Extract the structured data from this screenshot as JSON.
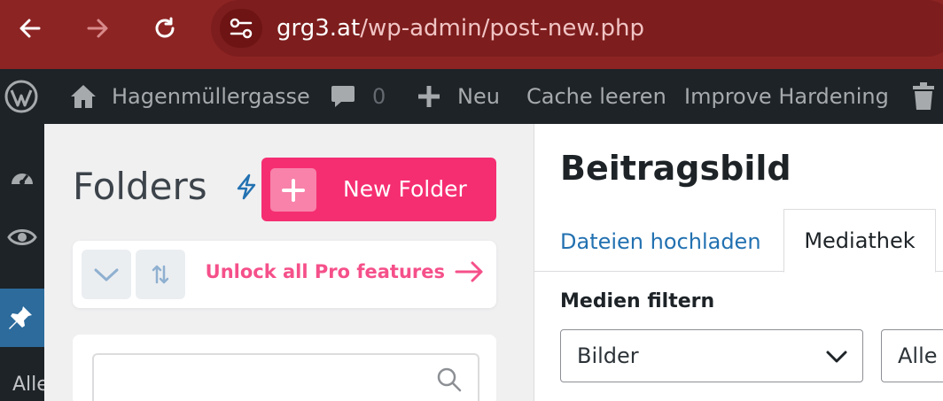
{
  "browser": {
    "url_host": "grg3.at",
    "url_path": "/wp-admin/post-new.php"
  },
  "admin_bar": {
    "site_name": "Hagenmüllergasse",
    "comments_count": "0",
    "new_label": "Neu",
    "cache_label": "Cache leeren",
    "hardening_label": "Improve Hardening"
  },
  "side_menu": {
    "partial_label": "Alle"
  },
  "folders": {
    "title": "Folders",
    "new_folder_label": "New Folder",
    "unlock_label": "Unlock all Pro features",
    "search_value": ""
  },
  "media_modal": {
    "title": "Beitragsbild",
    "tab_upload": "Dateien hochladen",
    "tab_library": "Mediathek",
    "filter_label": "Medien filtern",
    "filter_type_value": "Bilder",
    "filter_date_value": "Alle"
  },
  "colors": {
    "browser_bar": "#8d2424",
    "accent_pink": "#f52e72",
    "wp_blue": "#2271b1",
    "admin_bar": "#1d2327"
  }
}
